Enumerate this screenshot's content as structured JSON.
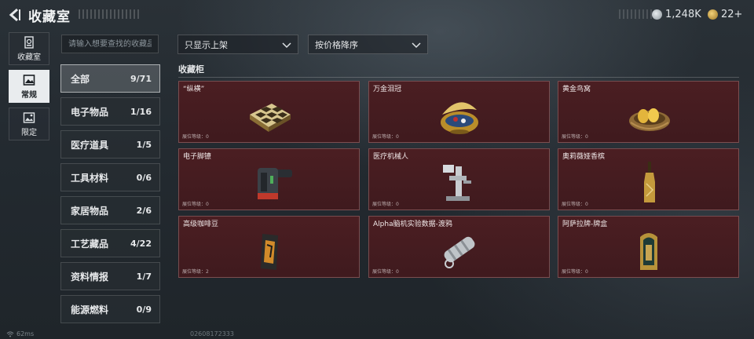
{
  "header": {
    "title": "收藏室",
    "currency_silver": "1,248K",
    "currency_gold": "22+"
  },
  "nav": [
    {
      "label": "收藏室",
      "icon": "collection-room-icon"
    },
    {
      "label": "常规",
      "icon": "image-frame-icon",
      "active": true
    },
    {
      "label": "限定",
      "icon": "limited-frame-icon"
    }
  ],
  "search": {
    "placeholder": "请输入想要查找的收藏品"
  },
  "categories": [
    {
      "label": "全部",
      "count": "9/71",
      "active": true
    },
    {
      "label": "电子物品",
      "count": "1/16"
    },
    {
      "label": "医疗道具",
      "count": "1/5"
    },
    {
      "label": "工具材料",
      "count": "0/6"
    },
    {
      "label": "家居物品",
      "count": "2/6"
    },
    {
      "label": "工艺藏品",
      "count": "4/22"
    },
    {
      "label": "资料情报",
      "count": "1/7"
    },
    {
      "label": "能源燃料",
      "count": "0/9"
    }
  ],
  "filters": {
    "shelf": "只显示上架",
    "sort": "按价格降序"
  },
  "section": {
    "title": "收藏柜"
  },
  "items": [
    {
      "name": "“纵横”",
      "level": "展位等级：0",
      "icon": "chess-board-icon"
    },
    {
      "name": "万金泪冠",
      "level": "展位等级：0",
      "icon": "jeweled-egg-icon"
    },
    {
      "name": "黄金鸟窝",
      "level": "展位等级：0",
      "icon": "golden-nest-icon"
    },
    {
      "name": "电子脚镣",
      "level": "展位等级：0",
      "icon": "electronic-ankle-monitor-icon"
    },
    {
      "name": "医疗机械人",
      "level": "展位等级：0",
      "icon": "medical-robot-icon"
    },
    {
      "name": "奥莉薇娅香槟",
      "level": "展位等级：0",
      "icon": "champagne-bottle-icon"
    },
    {
      "name": "高级咖啡豆",
      "level": "展位等级：2",
      "icon": "coffee-bag-icon"
    },
    {
      "name": "Alpha脑机实验数据-渡鸦",
      "level": "展位等级：0",
      "icon": "data-cylinder-icon"
    },
    {
      "name": "阿萨拉牌-牌盒",
      "level": "展位等级：0",
      "icon": "card-box-icon"
    }
  ],
  "status": {
    "ping": "62ms",
    "uid": "02608172333"
  },
  "colors": {
    "card_bg": "#4b1e22",
    "active_nav": "#e9ecee",
    "gold": "#c9a23a"
  }
}
